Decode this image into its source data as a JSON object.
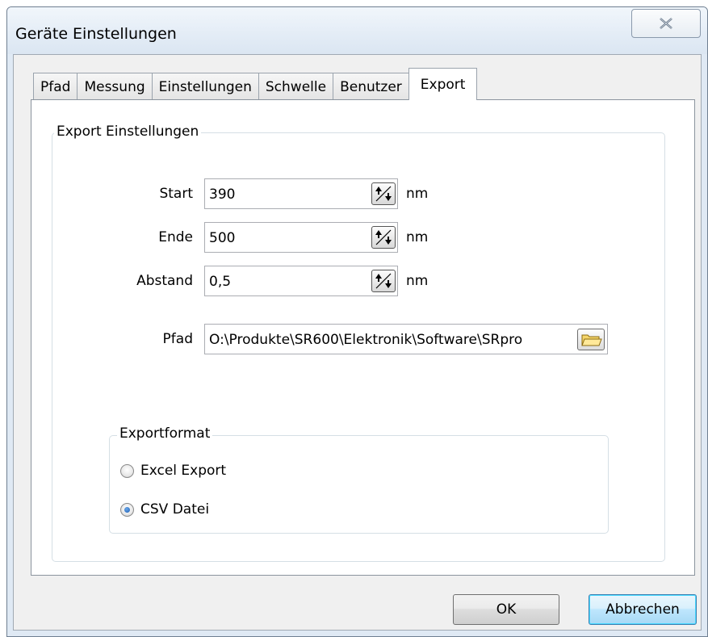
{
  "window": {
    "title": "Geräte Einstellungen"
  },
  "tabs": [
    {
      "label": "Pfad"
    },
    {
      "label": "Messung"
    },
    {
      "label": "Einstellungen"
    },
    {
      "label": "Schwelle"
    },
    {
      "label": "Benutzer"
    },
    {
      "label": "Export",
      "active": true
    }
  ],
  "export": {
    "group_label": "Export Einstellungen",
    "start": {
      "label": "Start",
      "value": "390",
      "unit": "nm"
    },
    "end": {
      "label": "Ende",
      "value": "500",
      "unit": "nm"
    },
    "step": {
      "label": "Abstand",
      "value": "0,5",
      "unit": "nm"
    },
    "path": {
      "label": "Pfad",
      "value": "O:\\Produkte\\SR600\\Elektronik\\Software\\SRpro"
    },
    "format": {
      "group_label": "Exportformat",
      "options": [
        {
          "label": "Excel Export",
          "checked": false
        },
        {
          "label": "CSV Datei",
          "checked": true
        }
      ]
    }
  },
  "buttons": {
    "ok": "OK",
    "cancel": "Abbrechen"
  },
  "colors": {
    "frame": "#dfe9f4",
    "client": "#f0f0f0",
    "default_button": "#a7d9f5"
  },
  "icons": {
    "close": "close-icon",
    "spin": "spin-updown-icon",
    "folder": "folder-icon"
  }
}
